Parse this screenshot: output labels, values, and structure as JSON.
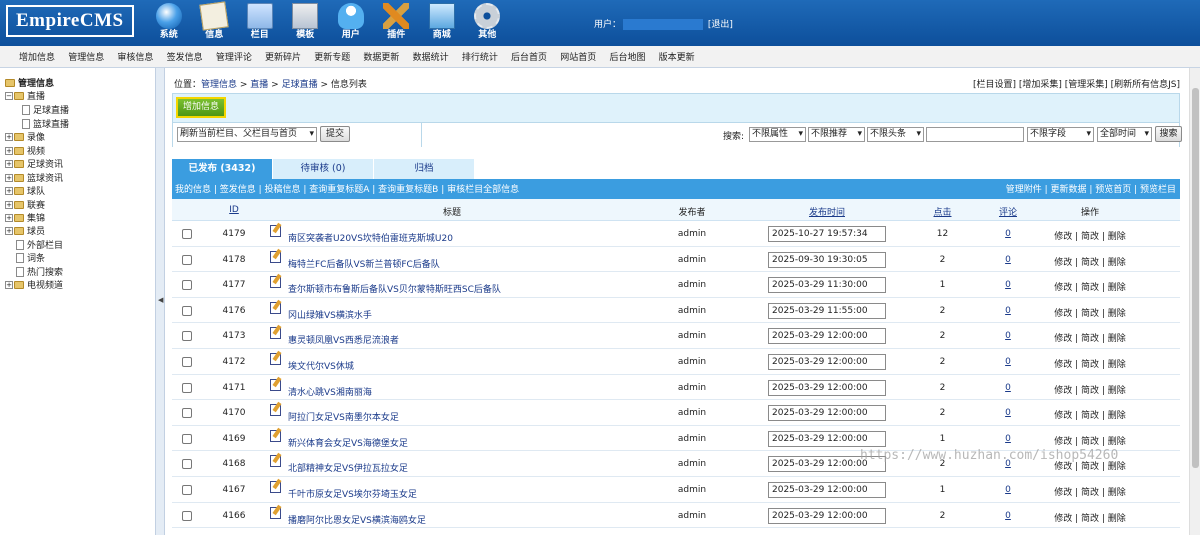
{
  "app": {
    "logo": "EmpireCMS",
    "top_nav": [
      {
        "label": "系统",
        "icon": "globe-icon"
      },
      {
        "label": "信息",
        "icon": "document-edit-icon"
      },
      {
        "label": "栏目",
        "icon": "folder-icon"
      },
      {
        "label": "模板",
        "icon": "template-icon"
      },
      {
        "label": "用户",
        "icon": "user-icon"
      },
      {
        "label": "插件",
        "icon": "tools-icon"
      },
      {
        "label": "商城",
        "icon": "shop-icon"
      },
      {
        "label": "其他",
        "icon": "gear-icon"
      }
    ],
    "user_label": "用户：",
    "logout": "[退出]"
  },
  "submenu": [
    "增加信息",
    "管理信息",
    "审核信息",
    "签发信息",
    "管理评论",
    "更新碎片",
    "更新专题",
    "数据更新",
    "数据统计",
    "排行统计",
    "后台首页",
    "网站首页",
    "后台地图",
    "版本更新"
  ],
  "sidebar": {
    "title": "管理信息",
    "nodes": [
      {
        "label": "直播",
        "level": 0,
        "expanded": true
      },
      {
        "label": "足球直播",
        "level": 1
      },
      {
        "label": "篮球直播",
        "level": 1
      },
      {
        "label": "录像",
        "level": 0
      },
      {
        "label": "视频",
        "level": 0
      },
      {
        "label": "足球资讯",
        "level": 0
      },
      {
        "label": "篮球资讯",
        "level": 0
      },
      {
        "label": "球队",
        "level": 0
      },
      {
        "label": "联赛",
        "level": 0
      },
      {
        "label": "集锦",
        "level": 0
      },
      {
        "label": "球员",
        "level": 0
      },
      {
        "label": "外部栏目",
        "level": "leaf"
      },
      {
        "label": "词条",
        "level": "leaf"
      },
      {
        "label": "热门搜索",
        "level": "leaf"
      },
      {
        "label": "电视频道",
        "level": 0
      }
    ]
  },
  "breadcrumb": {
    "prefix": "位置：",
    "items": [
      "管理信息",
      "直播",
      "足球直播",
      "信息列表"
    ],
    "sep": " > "
  },
  "top_links": "[栏目设置] [增加采集] [管理采集] [刷新所有信息JS]",
  "toolbar": {
    "add_button": "增加信息",
    "refresh_select": "刷新当前栏目、父栏目与首页",
    "submit": "提交",
    "search_label": "搜索:",
    "filters": [
      "不限属性",
      "不限推荐",
      "不限头条"
    ],
    "field_select": "不限字段",
    "time_select": "全部时间",
    "search_button": "搜索"
  },
  "tabs": [
    {
      "label": "已发布 (3432)",
      "active": true
    },
    {
      "label": "待审核 (0)",
      "active": false
    },
    {
      "label": "归档",
      "active": false
    }
  ],
  "linkbar": {
    "left": "我的信息 | 签发信息 | 投稿信息 | 查询重复标题A | 查询重复标题B | 审核栏目全部信息",
    "right": "管理附件 | 更新数据 | 预览首页 | 预览栏目"
  },
  "table": {
    "headers": [
      "ID",
      "标题",
      "发布者",
      "发布时间",
      "点击",
      "评论",
      "操作"
    ],
    "rows": [
      {
        "id": "4179",
        "title": "南区突袭者U20VS坎特伯雷班克斯城U20",
        "publisher": "admin",
        "time": "2025-10-27 19:57:34",
        "clicks": "12",
        "comments": "0"
      },
      {
        "id": "4178",
        "title": "梅特兰FC后备队VS新兰普顿FC后备队",
        "publisher": "admin",
        "time": "2025-09-30 19:30:05",
        "clicks": "2",
        "comments": "0"
      },
      {
        "id": "4177",
        "title": "查尔斯顿市布鲁斯后备队VS贝尔蒙特斯旺西SC后备队",
        "publisher": "admin",
        "time": "2025-03-29 11:30:00",
        "clicks": "1",
        "comments": "0"
      },
      {
        "id": "4176",
        "title": "冈山绿雉VS横滨水手",
        "publisher": "admin",
        "time": "2025-03-29 11:55:00",
        "clicks": "2",
        "comments": "0"
      },
      {
        "id": "4173",
        "title": "惠灵顿凤凰VS西悉尼流浪者",
        "publisher": "admin",
        "time": "2025-03-29 12:00:00",
        "clicks": "2",
        "comments": "0"
      },
      {
        "id": "4172",
        "title": "埃文代尔VS休城",
        "publisher": "admin",
        "time": "2025-03-29 12:00:00",
        "clicks": "2",
        "comments": "0"
      },
      {
        "id": "4171",
        "title": "清水心跳VS湘南丽海",
        "publisher": "admin",
        "time": "2025-03-29 12:00:00",
        "clicks": "2",
        "comments": "0"
      },
      {
        "id": "4170",
        "title": "阿拉门女足VS南墨尔本女足",
        "publisher": "admin",
        "time": "2025-03-29 12:00:00",
        "clicks": "2",
        "comments": "0"
      },
      {
        "id": "4169",
        "title": "新兴体育会女足VS海德堡女足",
        "publisher": "admin",
        "time": "2025-03-29 12:00:00",
        "clicks": "1",
        "comments": "0"
      },
      {
        "id": "4168",
        "title": "北部精神女足VS伊拉瓦拉女足",
        "publisher": "admin",
        "time": "2025-03-29 12:00:00",
        "clicks": "2",
        "comments": "0"
      },
      {
        "id": "4167",
        "title": "千叶市原女足VS埃尔芬埼玉女足",
        "publisher": "admin",
        "time": "2025-03-29 12:00:00",
        "clicks": "1",
        "comments": "0"
      },
      {
        "id": "4166",
        "title": "播磨阿尔比恩女足VS横滨海鸥女足",
        "publisher": "admin",
        "time": "2025-03-29 12:00:00",
        "clicks": "2",
        "comments": "0"
      }
    ],
    "ops": [
      "修改",
      "简改",
      "删除"
    ]
  },
  "watermark": "https://www.huzhan.com/ishop54260"
}
